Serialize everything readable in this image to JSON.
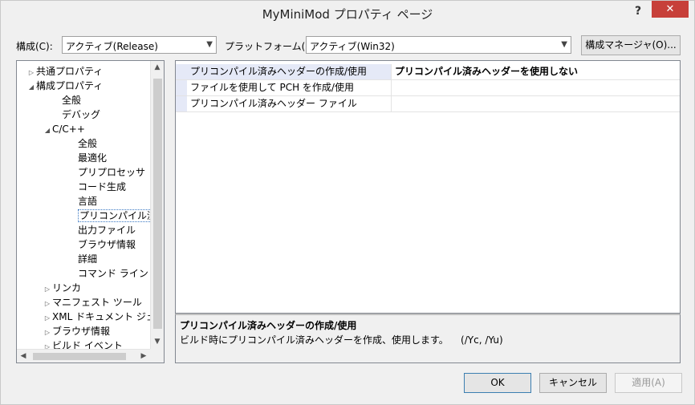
{
  "window": {
    "title": "MyMiniMod プロパティ ページ",
    "help_label": "?",
    "close_label": "✕"
  },
  "toolbar": {
    "config_label": "構成(C):",
    "config_value": "アクティブ(Release)",
    "platform_label": "プラットフォーム(P):",
    "platform_value": "アクティブ(Win32)",
    "config_manager_label": "構成マネージャ(O)..."
  },
  "tree": {
    "items": [
      {
        "label": "共通プロパティ",
        "toggle": "▷"
      },
      {
        "label": "構成プロパティ",
        "toggle": "◢"
      },
      {
        "label": "全般",
        "toggle": ""
      },
      {
        "label": "デバッグ",
        "toggle": ""
      },
      {
        "label": "C/C++",
        "toggle": "◢"
      },
      {
        "label": "全般",
        "toggle": ""
      },
      {
        "label": "最適化",
        "toggle": ""
      },
      {
        "label": "プリプロセッサ",
        "toggle": ""
      },
      {
        "label": "コード生成",
        "toggle": ""
      },
      {
        "label": "言語",
        "toggle": ""
      },
      {
        "label": "プリコンパイル済みヘッ",
        "toggle": ""
      },
      {
        "label": "出力ファイル",
        "toggle": ""
      },
      {
        "label": "ブラウザ情報",
        "toggle": ""
      },
      {
        "label": "詳細",
        "toggle": ""
      },
      {
        "label": "コマンド ライン",
        "toggle": ""
      },
      {
        "label": "リンカ",
        "toggle": "▷"
      },
      {
        "label": "マニフェスト ツール",
        "toggle": "▷"
      },
      {
        "label": "XML ドキュメント ジェネレ",
        "toggle": "▷"
      },
      {
        "label": "ブラウザ情報",
        "toggle": "▷"
      },
      {
        "label": "ビルド イベント",
        "toggle": "▷"
      }
    ],
    "scroll_up": "▲",
    "scroll_down": "▼",
    "scroll_left": "◀",
    "scroll_right": "▶"
  },
  "grid": {
    "rows": [
      {
        "name": "プリコンパイル済みヘッダーの作成/使用",
        "value": "プリコンパイル済みヘッダーを使用しない"
      },
      {
        "name": "ファイルを使用して PCH を作成/使用",
        "value": ""
      },
      {
        "name": "プリコンパイル済みヘッダー ファイル",
        "value": ""
      }
    ]
  },
  "description": {
    "title": "プリコンパイル済みヘッダーの作成/使用",
    "text": "ビルド時にプリコンパイル済みヘッダーを作成、使用します。    (/Yc, /Yu)"
  },
  "buttons": {
    "ok": "OK",
    "cancel": "キャンセル",
    "apply": "適用(A)"
  }
}
